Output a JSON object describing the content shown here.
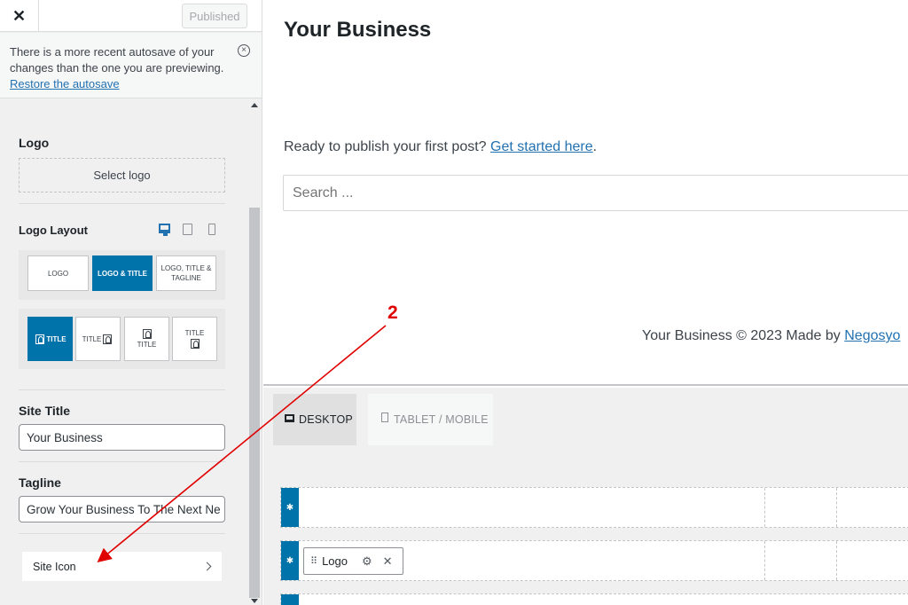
{
  "topbar": {
    "close_glyph": "✕",
    "published_label": "Published"
  },
  "autosave": {
    "message": "There is a more recent autosave of your changes than the one you are previewing.",
    "restore_link": "Restore the autosave",
    "dismiss_icon": "circle-x-icon"
  },
  "logo": {
    "label": "Logo",
    "select_button": "Select logo"
  },
  "logo_layout": {
    "label": "Logo Layout",
    "devices": [
      "desktop-icon",
      "tablet-icon",
      "mobile-icon"
    ],
    "options": [
      {
        "label": "LOGO",
        "active": false
      },
      {
        "label": "LOGO & TITLE",
        "active": true
      },
      {
        "label": "LOGO, TITLE & TAGLINE",
        "active": false
      }
    ],
    "positions": [
      {
        "label": "TITLE",
        "active": true
      },
      {
        "label": "TITLE",
        "active": false
      },
      {
        "label": "TITLE",
        "active": false
      },
      {
        "label": "TITLE",
        "active": false
      }
    ]
  },
  "site_title": {
    "label": "Site Title",
    "value": "Your Business"
  },
  "tagline": {
    "label": "Tagline",
    "value": "Grow Your Business To The Next Ne"
  },
  "site_icon": {
    "label": "Site Icon"
  },
  "preview": {
    "site_title": "Your Business",
    "ready_text": "Ready to publish your first post? ",
    "ready_link": "Get started here",
    "ready_end": ".",
    "search_placeholder": "Search ...",
    "footer_text": "Your Business © 2023 Made by ",
    "footer_link": "Negosyo"
  },
  "builder": {
    "tabs": [
      {
        "label": "DESKTOP",
        "active": true
      },
      {
        "label": "TABLET / MOBILE",
        "active": false
      }
    ],
    "logo_chip": "Logo"
  },
  "annotation": {
    "number": "2",
    "color": "#e00000"
  },
  "colors": {
    "accent": "#0073aa",
    "link": "#2271b1"
  }
}
